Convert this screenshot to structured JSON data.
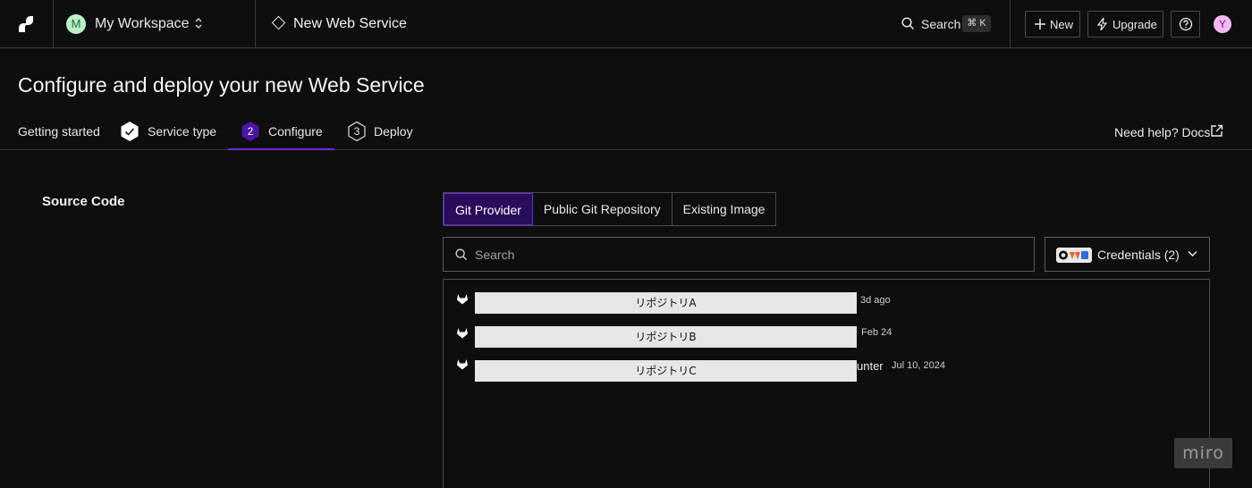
{
  "topbar": {
    "workspace_initial": "M",
    "workspace_name": "My Workspace",
    "page_name": "New Web Service",
    "search_label": "Search",
    "search_shortcut": "⌘ K",
    "new_label": "New",
    "upgrade_label": "Upgrade",
    "user_initial": "Y"
  },
  "page": {
    "title": "Configure and deploy your new Web Service",
    "help_text": "Need help? Docs"
  },
  "steps": [
    {
      "label": "Getting started"
    },
    {
      "label": "Service type",
      "state": "done"
    },
    {
      "number": "2",
      "label": "Configure",
      "state": "active"
    },
    {
      "number": "3",
      "label": "Deploy",
      "state": "pending"
    }
  ],
  "source": {
    "title": "Source Code",
    "tabs": [
      "Git Provider",
      "Public Git Repository",
      "Existing Image"
    ],
    "active_tab": "Git Provider",
    "search_placeholder": "Search",
    "credentials_label": "Credentials (2)",
    "repos": [
      {
        "name": "リポジトリA",
        "suffix": "",
        "date": "3d ago"
      },
      {
        "name": "リポジトリB",
        "suffix": "",
        "date": "Feb 24"
      },
      {
        "name": "リポジトリC",
        "suffix": "unter",
        "date": "Jul 10, 2024"
      }
    ]
  },
  "watermark": "miro",
  "colors": {
    "accent": "#6c2bd9",
    "active_tab_bg": "#2a0b5c",
    "background": "#0e0e0e"
  }
}
